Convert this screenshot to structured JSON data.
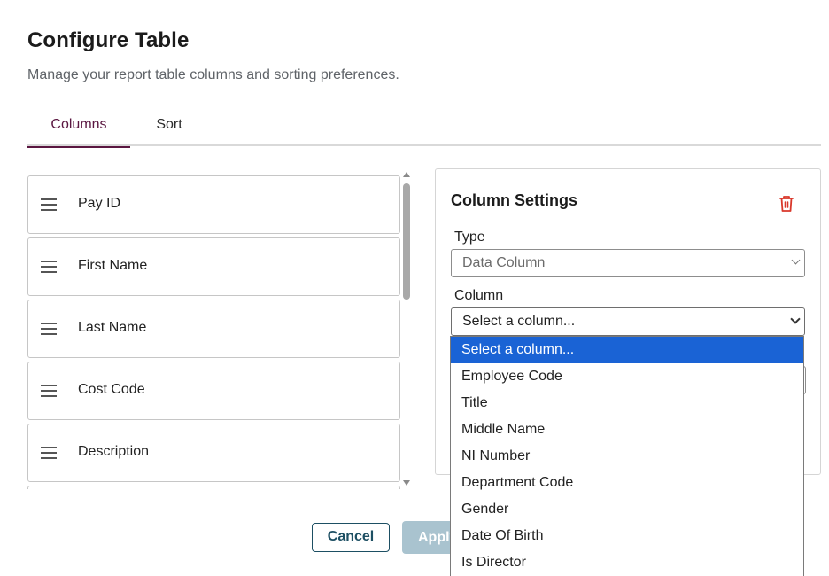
{
  "header": {
    "title": "Configure Table",
    "subtitle": "Manage your report table columns and sorting preferences."
  },
  "tabs": [
    {
      "label": "Columns",
      "active": true
    },
    {
      "label": "Sort",
      "active": false
    }
  ],
  "columns_list": [
    {
      "label": "Pay ID"
    },
    {
      "label": "First Name"
    },
    {
      "label": "Last Name"
    },
    {
      "label": "Cost Code"
    },
    {
      "label": "Description"
    }
  ],
  "settings": {
    "title": "Column Settings",
    "delete_icon": "trash-icon",
    "type_label": "Type",
    "type_value": "Data Column",
    "column_label": "Column",
    "column_value": "Select a column..."
  },
  "dropdown": {
    "options": [
      "Select a column...",
      "Employee Code",
      "Title",
      "Middle Name",
      "NI Number",
      "Department Code",
      "Gender",
      "Date Of Birth",
      "Is Director"
    ],
    "selected_index": 0
  },
  "footer": {
    "cancel_label": "Cancel",
    "apply_label": "Apply"
  },
  "colors": {
    "accent": "#5a1640",
    "selection": "#1a63d5",
    "button_primary_disabled": "#a9c3cf",
    "button_secondary": "#1d4f63",
    "danger": "#d9382b"
  }
}
